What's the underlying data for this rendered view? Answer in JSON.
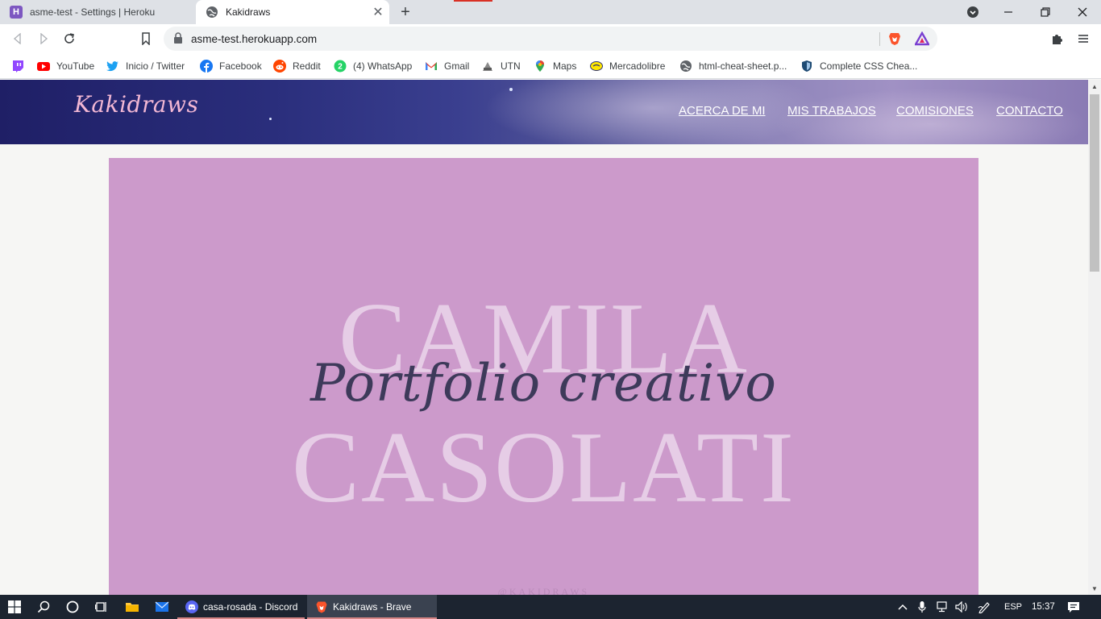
{
  "tabs": [
    {
      "title": "asme-test - Settings | Heroku",
      "favicon": "heroku-icon",
      "favicon_letter": "H"
    },
    {
      "title": "Kakidraws",
      "favicon": "globe-icon"
    }
  ],
  "toolbar": {
    "url": "asme-test.herokuapp.com"
  },
  "bookmarks": [
    {
      "label": "",
      "icon": "twitch-icon"
    },
    {
      "label": "YouTube",
      "icon": "youtube-icon"
    },
    {
      "label": "Inicio / Twitter",
      "icon": "twitter-icon"
    },
    {
      "label": "Facebook",
      "icon": "facebook-icon"
    },
    {
      "label": "Reddit",
      "icon": "reddit-icon"
    },
    {
      "label": "(4) WhatsApp",
      "icon": "whatsapp-icon",
      "badge": "2"
    },
    {
      "label": "Gmail",
      "icon": "gmail-icon"
    },
    {
      "label": "UTN",
      "icon": "utn-icon"
    },
    {
      "label": "Maps",
      "icon": "maps-icon"
    },
    {
      "label": "Mercadolibre",
      "icon": "mercadolibre-icon"
    },
    {
      "label": "html-cheat-sheet.p...",
      "icon": "globe-icon"
    },
    {
      "label": "Complete CSS Chea...",
      "icon": "shield-icon"
    }
  ],
  "site": {
    "logo": "Kakidraws",
    "nav": [
      "ACERCA DE MI",
      "MIS TRABAJOS",
      "COMISIONES",
      "CONTACTO"
    ],
    "hero": {
      "name_line1": "CAMILA",
      "name_line2": "CASOLATI",
      "script": "Portfolio creativo",
      "handle": "@KAKIDRAWS"
    }
  },
  "taskbar": {
    "apps": [
      {
        "label": "casa-rosada - Discord",
        "icon": "discord-icon"
      },
      {
        "label": "Kakidraws - Brave",
        "icon": "brave-icon"
      }
    ],
    "language": "ESP",
    "time": "15:37"
  },
  "colors": {
    "hero_bg": "#cc9acb",
    "logo": "#f3b8d4",
    "taskbar": "#1c2430"
  }
}
